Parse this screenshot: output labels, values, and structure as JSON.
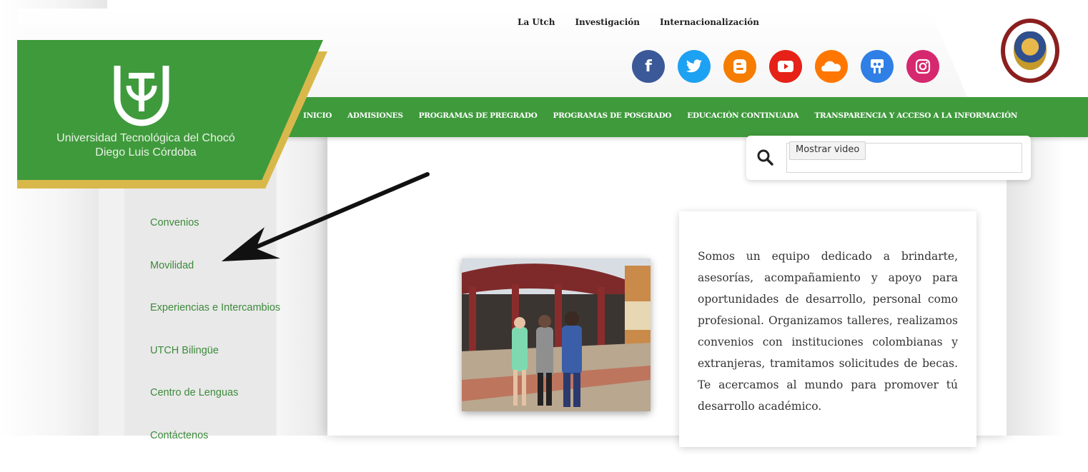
{
  "header": {
    "top_links": [
      "La Utch",
      "Investigación",
      "Internacionalización"
    ],
    "social": [
      {
        "name": "facebook",
        "glyph": "f",
        "color": "#3b5998"
      },
      {
        "name": "twitter",
        "glyph": "🐦",
        "color": "#1da1f2"
      },
      {
        "name": "blogger",
        "glyph": "B",
        "color": "#f57d00"
      },
      {
        "name": "youtube",
        "glyph": "▶",
        "color": "#e62117"
      },
      {
        "name": "soundcloud",
        "glyph": "☁",
        "color": "#ff7700"
      },
      {
        "name": "slideshare",
        "glyph": "▣",
        "color": "#2f7fe6"
      },
      {
        "name": "instagram",
        "glyph": "◎",
        "color": "#d6286e"
      }
    ],
    "seal_icon": "colombia-coat-of-arms-seal"
  },
  "logo": {
    "line1": "Universidad Tecnológica del Chocó",
    "line2": "Diego Luis Córdoba"
  },
  "nav": {
    "items": [
      "INICIO",
      "ADMISIONES",
      "PROGRAMAS DE PREGRADO",
      "PROGRAMAS DE POSGRADO",
      "EDUCACIÓN CONTINUADA",
      "TRANSPARENCIA Y ACCESO A LA INFORMACIÓN"
    ]
  },
  "search": {
    "tooltip": "Mostrar video",
    "value": ""
  },
  "sidebar": {
    "items": [
      {
        "label": "Convenios"
      },
      {
        "label": "Movilidad"
      },
      {
        "label": "Experiencias e Intercambios"
      },
      {
        "label": "UTCH Bilingüe"
      },
      {
        "label": "Centro de Lenguas"
      },
      {
        "label": "Contáctenos"
      }
    ]
  },
  "main": {
    "description": "Somos un equipo dedicado a brindarte, asesorías, acompañamiento y apoyo para oportunidades de desarrollo, personal como profesional. Organizamos talleres, realizamos convenios con instituciones colombianas y extranjeras, tramitamos solicitudes de becas. Te acercamos al mundo para promover tú desarrollo académico."
  },
  "colors": {
    "brand_green": "#3f9a3c",
    "brand_gold": "#d9b84b",
    "sidebar_link": "#3c8a3a"
  }
}
